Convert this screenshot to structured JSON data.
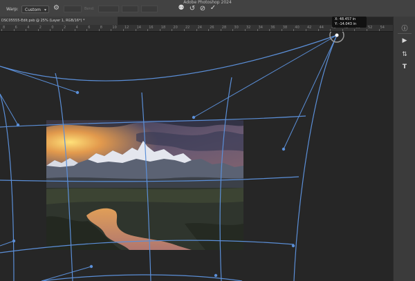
{
  "app": {
    "title": "Adobe Photoshop 2024"
  },
  "options": {
    "warp_label": "Warp:",
    "warp_value": "Custom",
    "bend_label": "Bend:"
  },
  "document": {
    "tab": "DSC05555-Edit.psb @ 25% (Layer 1, RGB/16*) *"
  },
  "ruler": {
    "labels": [
      "8",
      "6",
      "4",
      "2",
      "0",
      "2",
      "4",
      "6",
      "8",
      "10",
      "12",
      "14",
      "16",
      "18",
      "20",
      "22",
      "24",
      "26",
      "28",
      "30",
      "32",
      "34",
      "36",
      "38",
      "40",
      "42",
      "44",
      "46",
      "48",
      "50",
      "52",
      "54"
    ]
  },
  "readout": {
    "x": "X: 48.457 in",
    "y": "Y: -14.043 in"
  },
  "colors": {
    "mesh": "#5b8fd8",
    "background": "#262626",
    "toolbar": "#424242"
  },
  "icons": {
    "warp_mode": "warp-grid-icon",
    "cancel": "cancel-icon",
    "commit": "checkmark-icon",
    "undo": "reset-icon",
    "info": "info-icon",
    "play": "play-icon",
    "adjust": "adjust-icon",
    "type": "type-icon"
  }
}
